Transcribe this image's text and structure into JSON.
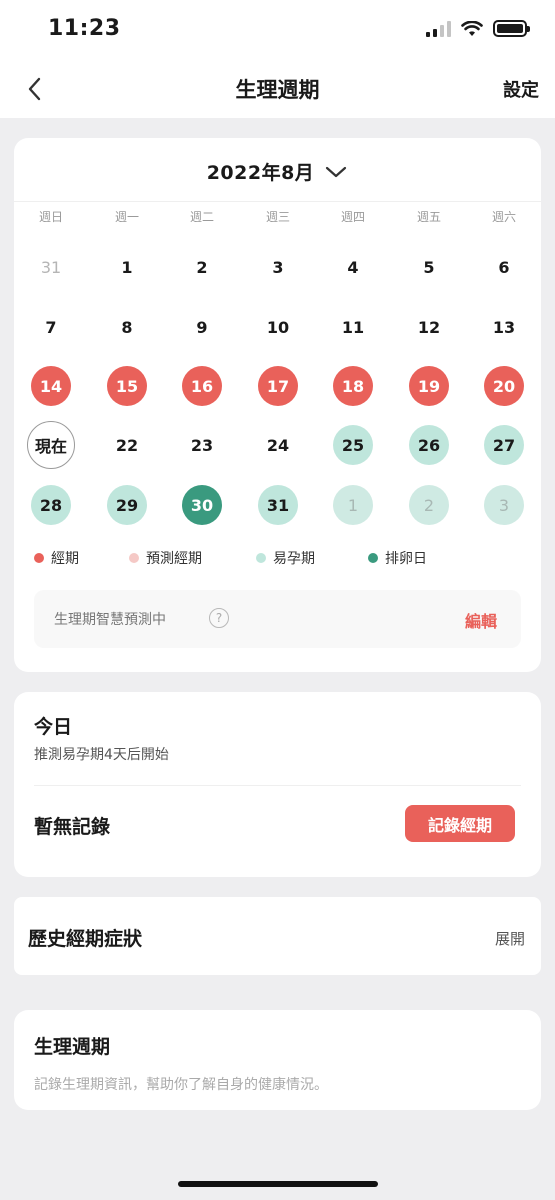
{
  "status_bar": {
    "time": "11:23"
  },
  "nav": {
    "title": "生理週期",
    "settings_label": "設定"
  },
  "calendar": {
    "month_label": "2022年8月",
    "weekdays": [
      "週日",
      "週一",
      "週二",
      "週三",
      "週四",
      "週五",
      "週六"
    ],
    "weeks": [
      [
        "31",
        "1",
        "2",
        "3",
        "4",
        "5",
        "6"
      ],
      [
        "7",
        "8",
        "9",
        "10",
        "11",
        "12",
        "13"
      ],
      [
        "14",
        "15",
        "16",
        "17",
        "18",
        "19",
        "20"
      ],
      [
        "現在",
        "22",
        "23",
        "24",
        "25",
        "26",
        "27"
      ],
      [
        "28",
        "29",
        "30",
        "31",
        "1",
        "2",
        "3"
      ]
    ],
    "legend": [
      "經期",
      "預測經期",
      "易孕期",
      "排卵日"
    ],
    "colors": {
      "period": "#e9615a",
      "predicted_period": "#f5c9c6",
      "fertile": "#bfe6dc",
      "ovulation": "#3a9a7f"
    },
    "prediction_text": "生理期智慧預測中",
    "help_glyph": "?",
    "edit_label": "編輯"
  },
  "today": {
    "title": "今日",
    "subtitle": "推測易孕期4天后開始",
    "no_record": "暫無記錄",
    "record_button": "記錄經期"
  },
  "history": {
    "title": "歷史經期症狀",
    "expand_label": "展開"
  },
  "info": {
    "title": "生理週期",
    "description": "記錄生理期資訊，幫助你了解自身的健康情況。"
  }
}
